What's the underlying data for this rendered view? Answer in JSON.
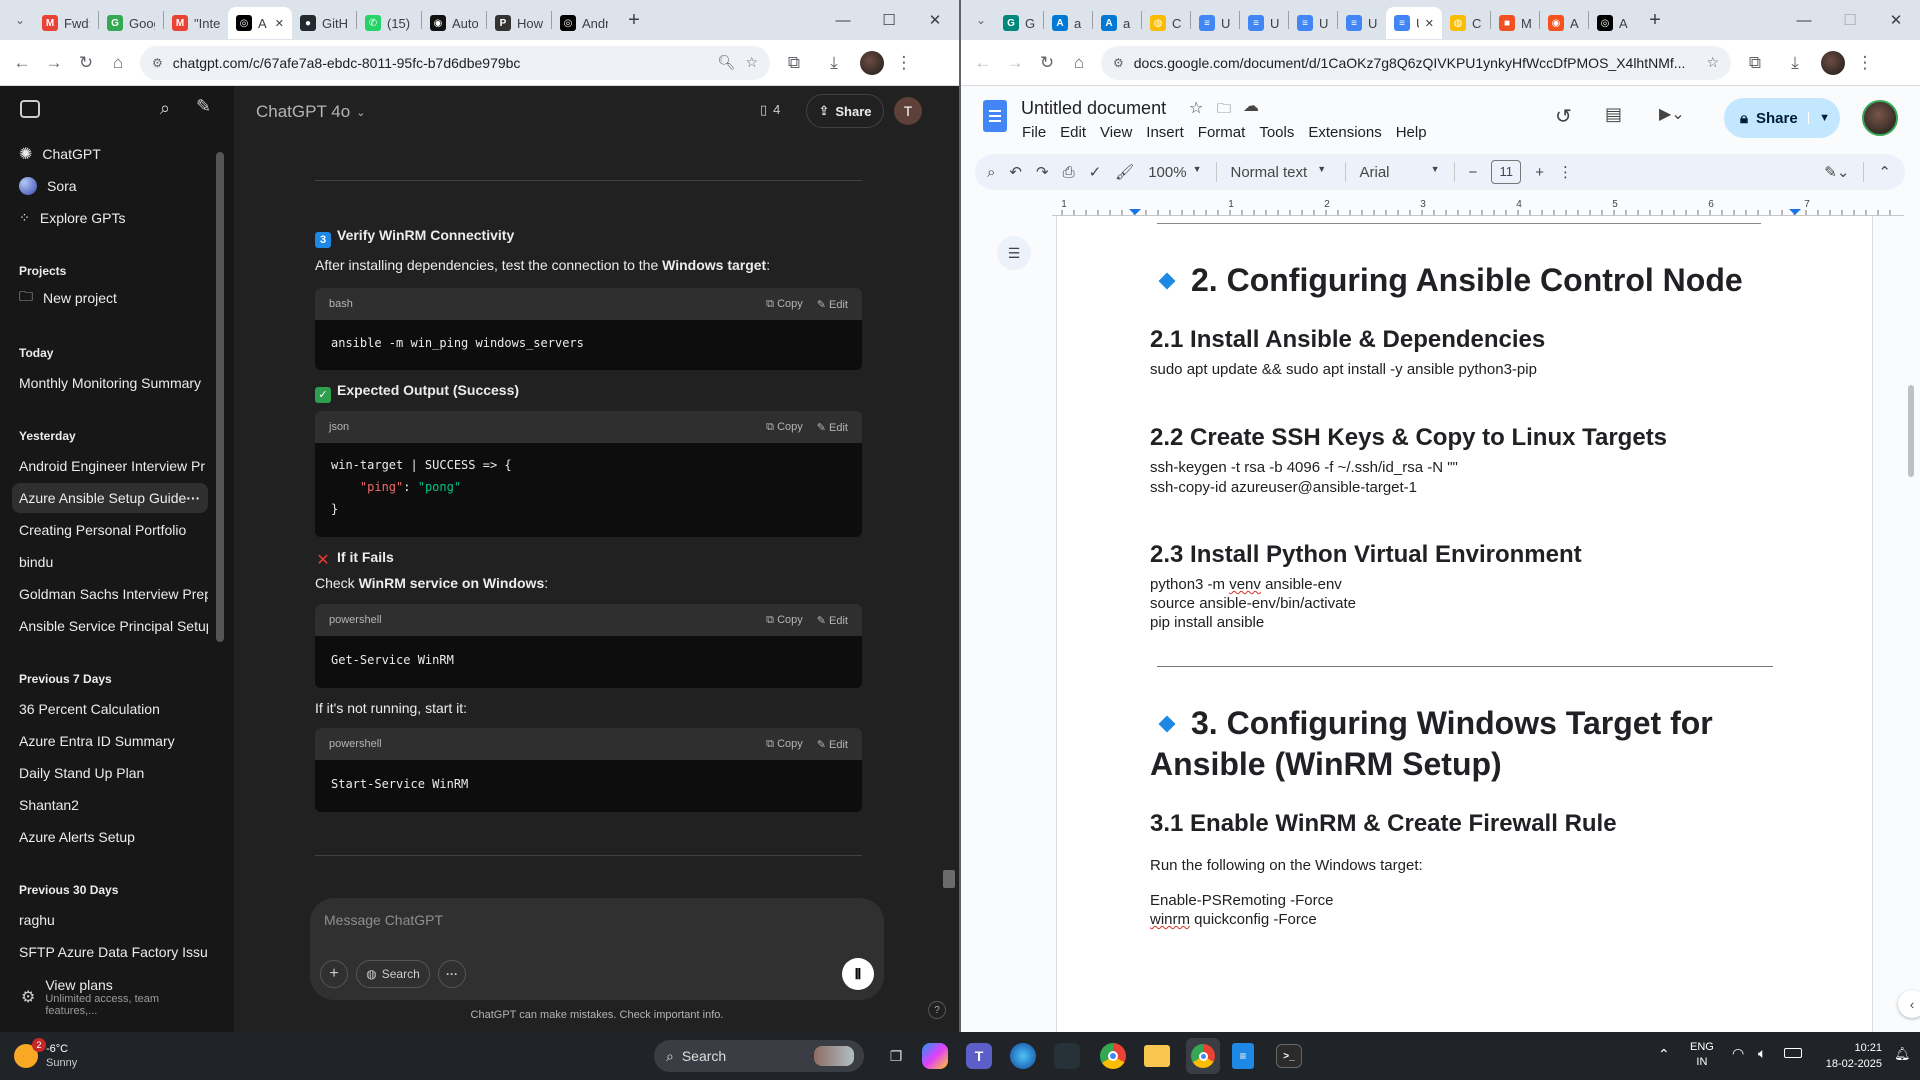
{
  "left_browser": {
    "tabs": [
      {
        "label": "Fwd:",
        "icon": "gmail-icon",
        "color": "#ea4335",
        "glyph": "M"
      },
      {
        "label": "Goog",
        "icon": "google-icon",
        "color": "#34a853",
        "glyph": "G"
      },
      {
        "label": "\"Inter",
        "icon": "gmail-icon",
        "color": "#ea4335",
        "glyph": "M"
      },
      {
        "label": "A",
        "icon": "chatgpt-icon",
        "color": "#000000",
        "glyph": "◎",
        "active": true
      },
      {
        "label": "GitHu",
        "icon": "github-icon",
        "color": "#24292f",
        "glyph": "●"
      },
      {
        "label": "(15) V",
        "icon": "whatsapp-icon",
        "color": "#25d366",
        "glyph": "✆"
      },
      {
        "label": "Autor",
        "icon": "ai-icon",
        "color": "#111111",
        "glyph": "◉"
      },
      {
        "label": "How",
        "icon": "poe-icon",
        "color": "#333333",
        "glyph": "P"
      },
      {
        "label": "Andr",
        "icon": "chatgpt-icon",
        "color": "#000000",
        "glyph": "◎"
      }
    ],
    "url": "chatgpt.com/c/67afe7a8-ebdc-8011-95fc-b7d6dbe979bc"
  },
  "chatgpt": {
    "sidebar": {
      "top": [
        {
          "label": "ChatGPT"
        },
        {
          "label": "Sora"
        },
        {
          "label": "Explore GPTs"
        }
      ],
      "projects_heading": "Projects",
      "new_project": "New project",
      "groups": [
        {
          "heading": "Today",
          "items": [
            "Monthly Monitoring Summary"
          ]
        },
        {
          "heading": "Yesterday",
          "items": [
            "Android Engineer Interview Pr",
            "Azure Ansible Setup Guide",
            "Creating Personal Portfolio",
            "bindu",
            "Goldman Sachs Interview Prep",
            "Ansible Service Principal Setup"
          ]
        },
        {
          "heading": "Previous 7 Days",
          "items": [
            "36 Percent Calculation",
            "Azure Entra ID Summary",
            "Daily Stand Up Plan",
            "Shantan2",
            "Azure Alerts Setup"
          ]
        },
        {
          "heading": "Previous 30 Days",
          "items": [
            "raghu",
            "SFTP Azure Data Factory Issue"
          ]
        }
      ],
      "view_plans": "View plans",
      "view_plans_sub": "Unlimited access, team features,..."
    },
    "header": {
      "model": "ChatGPT 4o",
      "doc_count": "4",
      "share": "Share",
      "avatar_letter": "T"
    },
    "content": {
      "step_number": "3",
      "step_title": "Verify WinRM Connectivity",
      "intro_pre": "After installing dependencies, test the connection to the ",
      "intro_bold": "Windows target",
      "intro_post": ":",
      "copy": "Copy",
      "edit": "Edit",
      "block1_lang": "bash",
      "block1_code": "ansible -m win_ping windows_servers",
      "expected_title": "Expected Output (Success)",
      "block2_lang": "json",
      "block2_line1": "win-target | SUCCESS => {",
      "block2_key": "\"ping\"",
      "block2_colon": ": ",
      "block2_val": "\"pong\"",
      "block2_line3": "}",
      "fail_title": "If it Fails",
      "check_pre": "Check ",
      "check_bold": "WinRM service on Windows",
      "check_post": ":",
      "block3_lang": "powershell",
      "block3_code": "Get-Service WinRM",
      "not_running": "If it's not running, start it:",
      "block4_lang": "powershell",
      "block4_code": "Start-Service WinRM"
    },
    "composer": {
      "placeholder": "Message ChatGPT",
      "search": "Search",
      "disclaimer": "ChatGPT can make mistakes. Check important info.",
      "help": "?"
    }
  },
  "right_browser": {
    "tabs": [
      {
        "label": "G",
        "icon": "google-meet-icon",
        "color": "#00897b",
        "glyph": "G"
      },
      {
        "label": "a",
        "icon": "azure-icon",
        "color": "#0078d4",
        "glyph": "A"
      },
      {
        "label": "a",
        "icon": "azure-icon",
        "color": "#0078d4",
        "glyph": "A"
      },
      {
        "label": "C",
        "icon": "chrome-icon",
        "color": "#fbbc04",
        "glyph": "◍"
      },
      {
        "label": "U",
        "icon": "docs-icon",
        "color": "#4285f4",
        "glyph": "≡"
      },
      {
        "label": "U",
        "icon": "docs-icon",
        "color": "#4285f4",
        "glyph": "≡"
      },
      {
        "label": "U",
        "icon": "docs-icon",
        "color": "#4285f4",
        "glyph": "≡"
      },
      {
        "label": "U",
        "icon": "docs-icon",
        "color": "#4285f4",
        "glyph": "≡"
      },
      {
        "label": "U",
        "icon": "docs-icon",
        "color": "#4285f4",
        "glyph": "≡",
        "active": true
      },
      {
        "label": "C",
        "icon": "chrome-icon",
        "color": "#fbbc04",
        "glyph": "◍"
      },
      {
        "label": "M",
        "icon": "microsoft-icon",
        "color": "#f25022",
        "glyph": "■"
      },
      {
        "label": "A",
        "icon": "ai-icon",
        "color": "#f4511e",
        "glyph": "◉"
      },
      {
        "label": "A",
        "icon": "chatgpt-icon",
        "color": "#000000",
        "glyph": "◎"
      }
    ],
    "url": "docs.google.com/document/d/1CaOKz7g8Q6zQIVKPU1ynkyHfWccDfPMOS_X4lhtNMf..."
  },
  "docs": {
    "title": "Untitled document",
    "menu": [
      "File",
      "Edit",
      "View",
      "Insert",
      "Format",
      "Tools",
      "Extensions",
      "Help"
    ],
    "share": "Share",
    "zoom": "100%",
    "style": "Normal text",
    "font": "Arial",
    "font_size": "11",
    "ruler_numbers": [
      "1",
      "1",
      "2",
      "3",
      "4",
      "5",
      "6",
      "7"
    ],
    "content": {
      "h1_a": "2. Configuring Ansible Control Node",
      "h2_1": "2.1 Install Ansible & Dependencies",
      "p_1": "sudo apt update && sudo apt install -y ansible python3-pip",
      "h2_2": "2.2 Create SSH Keys & Copy to Linux Targets",
      "p_2a": "ssh-keygen -t rsa -b 4096 -f ~/.ssh/id_rsa -N \"\"",
      "p_2b": "ssh-copy-id azureuser@ansible-target-1",
      "h2_3": "2.3 Install Python Virtual Environment",
      "p_3a_pre": "python3 -m ",
      "p_3a_sq": "venv",
      "p_3a_post": " ansible-env",
      "p_3b": "source ansible-env/bin/activate",
      "p_3c": "pip install ansible",
      "h1_b_line1": "3. Configuring Windows Target for",
      "h1_b_line2": "Ansible (WinRM Setup)",
      "h2_4": "3.1 Enable WinRM & Create Firewall Rule",
      "p_4": "Run the following on the Windows target:",
      "p_5a": "Enable-PSRemoting -Force",
      "p_5b_sq": "winrm",
      "p_5b_post": " quickconfig -Force"
    }
  },
  "taskbar": {
    "weather_temp": "-6°C",
    "weather_cond": "Sunny",
    "weather_badge": "2",
    "search": "Search",
    "lang_top": "ENG",
    "lang_bottom": "IN",
    "time": "10:21",
    "date": "18-02-2025"
  }
}
